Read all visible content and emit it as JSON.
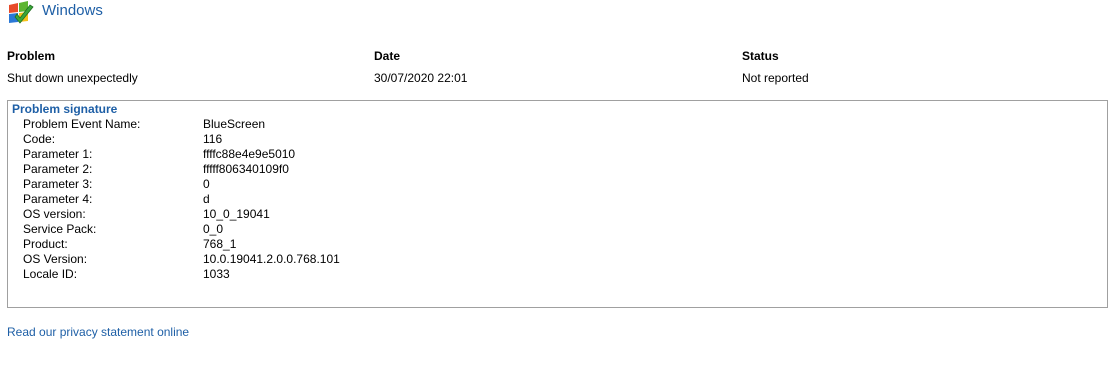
{
  "header": {
    "title": "Windows",
    "icon": "windows-defender-flag-check-icon"
  },
  "columns": {
    "problem_header": "Problem",
    "date_header": "Date",
    "status_header": "Status",
    "problem_value": "Shut down unexpectedly",
    "date_value": "30/07/2020 22:01",
    "status_value": "Not reported"
  },
  "signature": {
    "title": "Problem signature",
    "rows": [
      {
        "key": "Problem Event Name:",
        "value": "BlueScreen"
      },
      {
        "key": "Code:",
        "value": "116"
      },
      {
        "key": "Parameter 1:",
        "value": "ffffc88e4e9e5010"
      },
      {
        "key": "Parameter 2:",
        "value": "fffff806340109f0"
      },
      {
        "key": "Parameter 3:",
        "value": "0"
      },
      {
        "key": "Parameter 4:",
        "value": "d"
      },
      {
        "key": "OS version:",
        "value": "10_0_19041"
      },
      {
        "key": "Service Pack:",
        "value": "0_0"
      },
      {
        "key": "Product:",
        "value": "768_1"
      },
      {
        "key": "OS Version:",
        "value": "10.0.19041.2.0.0.768.101"
      },
      {
        "key": "Locale ID:",
        "value": "1033"
      }
    ]
  },
  "footer": {
    "privacy_link": "Read our privacy statement online"
  },
  "colors": {
    "accent": "#1e5fa6",
    "border": "#a0a0a0"
  }
}
